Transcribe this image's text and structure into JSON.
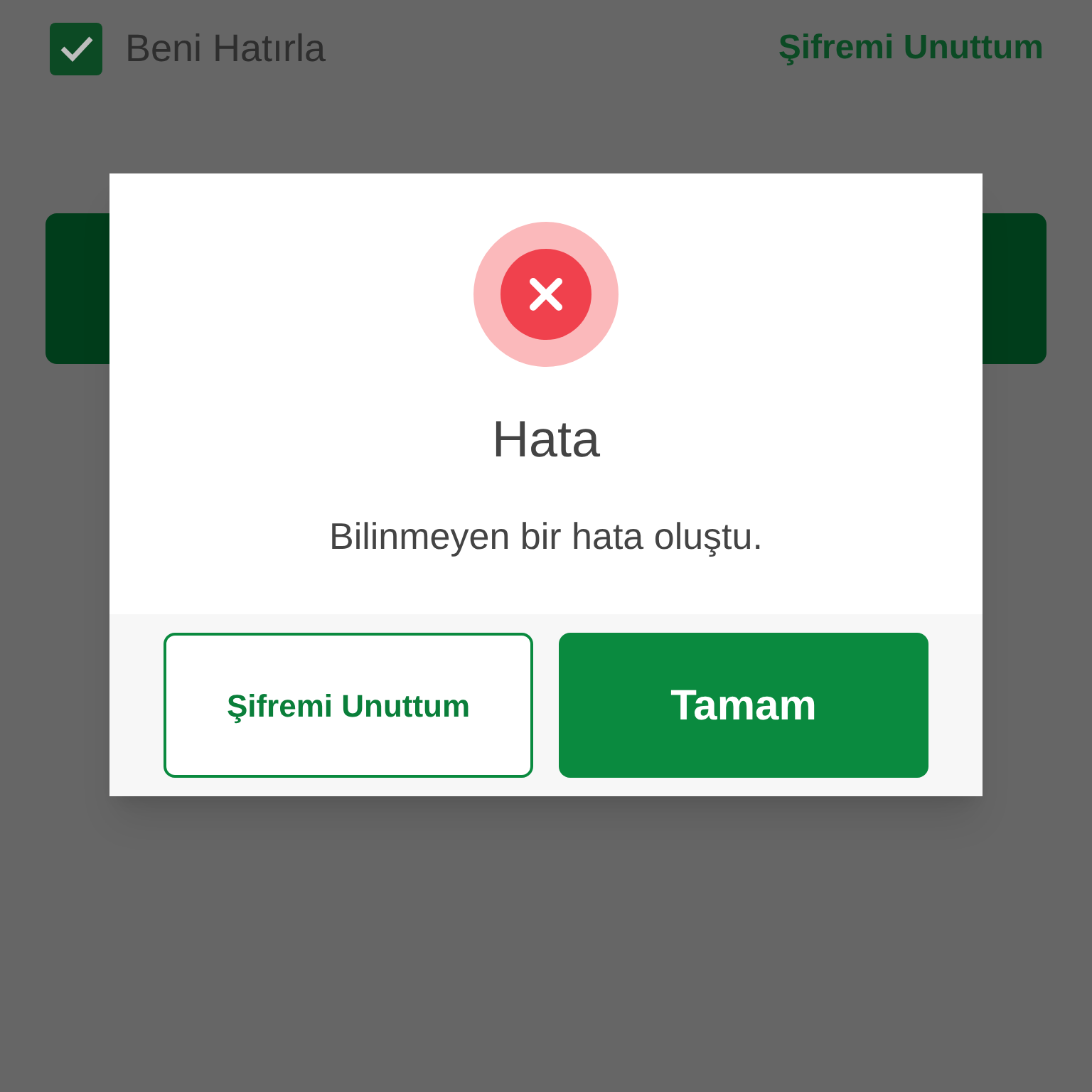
{
  "remember_me": {
    "label": "Beni Hatırla",
    "checked": true
  },
  "forgot_link": "Şifremi Unuttum",
  "dialog": {
    "kind": "error",
    "title": "Hata",
    "message": "Bilinmeyen bir hata oluştu.",
    "buttons": [
      {
        "label": "Şifremi Unuttum",
        "kind": "outline"
      },
      {
        "label": "Tamam",
        "kind": "primary"
      }
    ]
  }
}
